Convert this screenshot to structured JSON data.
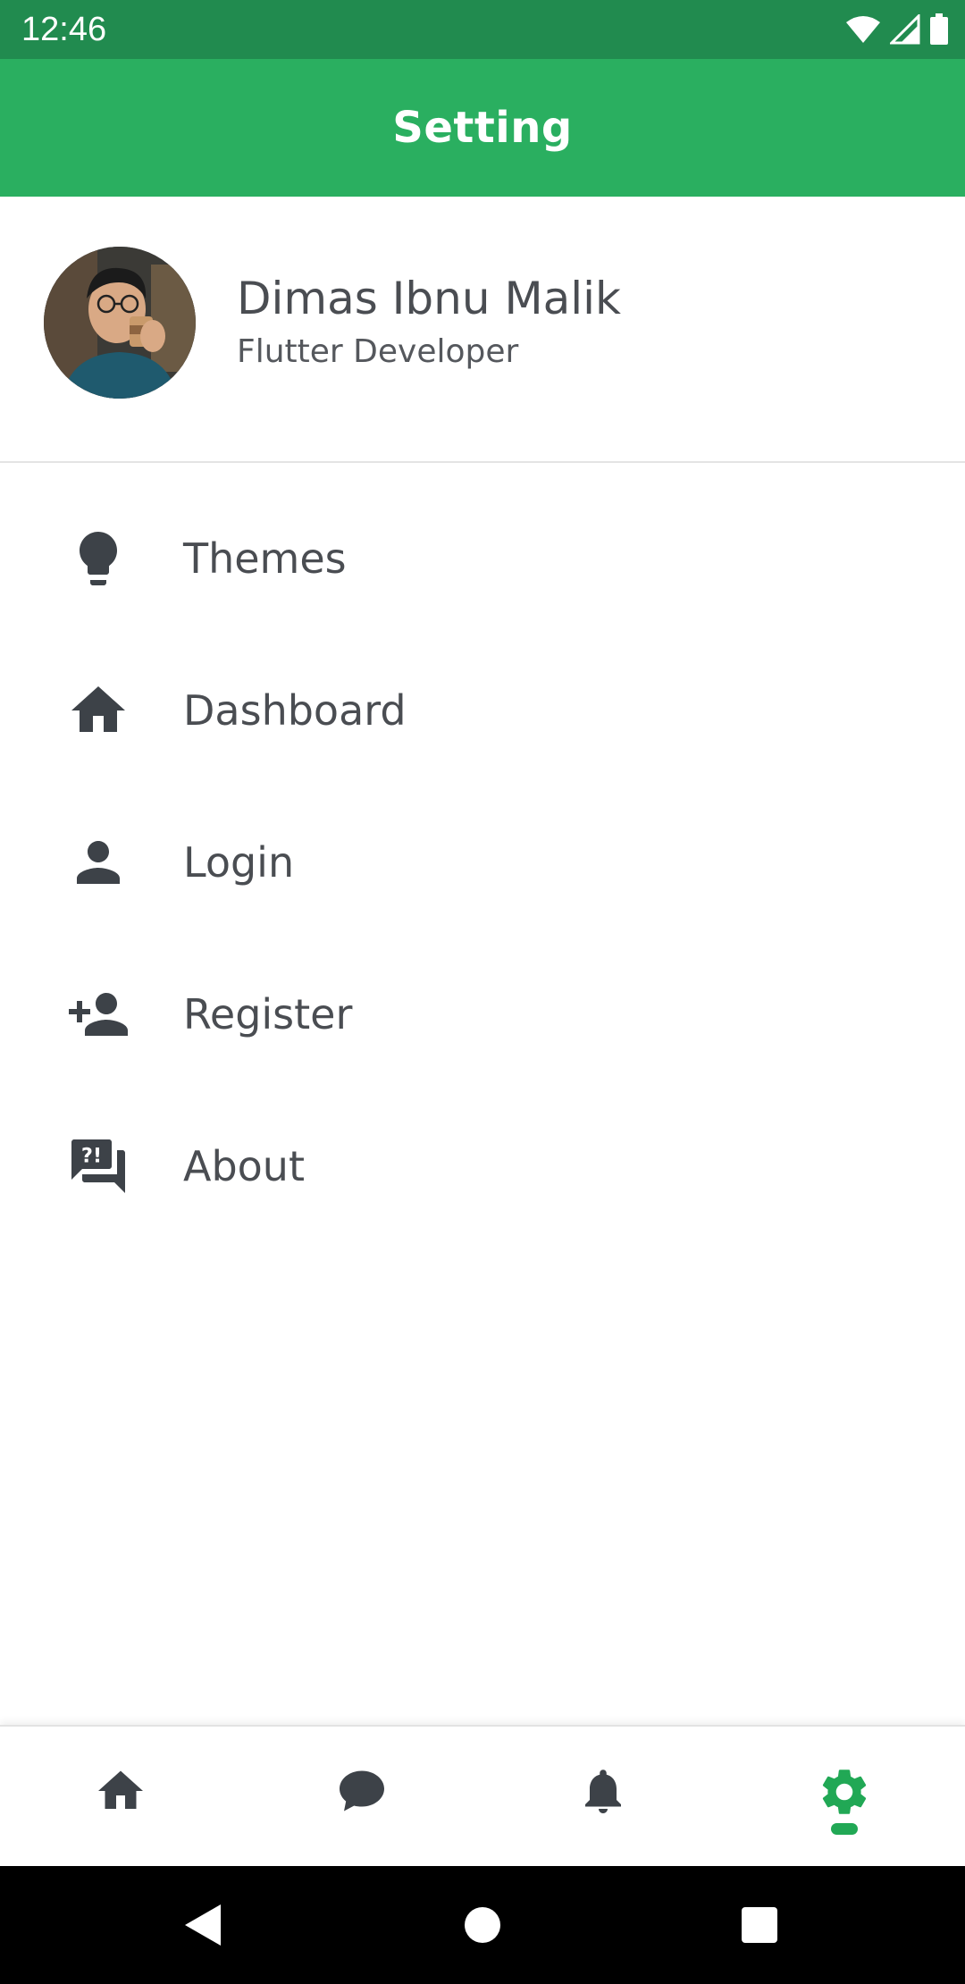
{
  "status_bar": {
    "time": "12:46",
    "icons": [
      "wifi-icon",
      "cellular-signal-icon",
      "battery-icon"
    ],
    "background_color": "#218b4f"
  },
  "app_bar": {
    "title": "Setting",
    "background_color": "#2aaf60"
  },
  "profile": {
    "name": "Dimas Ibnu Malik",
    "role": "Flutter Developer",
    "avatar": "avatar-photo"
  },
  "menu": {
    "items": [
      {
        "label": "Themes",
        "icon": "lightbulb-icon"
      },
      {
        "label": "Dashboard",
        "icon": "home-icon"
      },
      {
        "label": "Login",
        "icon": "person-icon"
      },
      {
        "label": "Register",
        "icon": "person-add-icon"
      },
      {
        "label": "About",
        "icon": "forum-question-icon"
      }
    ],
    "text_color": "#4a4d52"
  },
  "bottom_nav": {
    "items": [
      {
        "icon": "home-icon",
        "active": false
      },
      {
        "icon": "chat-bubble-icon",
        "active": false
      },
      {
        "icon": "bell-icon",
        "active": false
      },
      {
        "icon": "gear-icon",
        "active": true
      }
    ],
    "active_color": "#21a855",
    "inactive_color": "#3d4248"
  },
  "system_nav": {
    "buttons": [
      "back-icon",
      "home-circle-icon",
      "recents-square-icon"
    ]
  }
}
